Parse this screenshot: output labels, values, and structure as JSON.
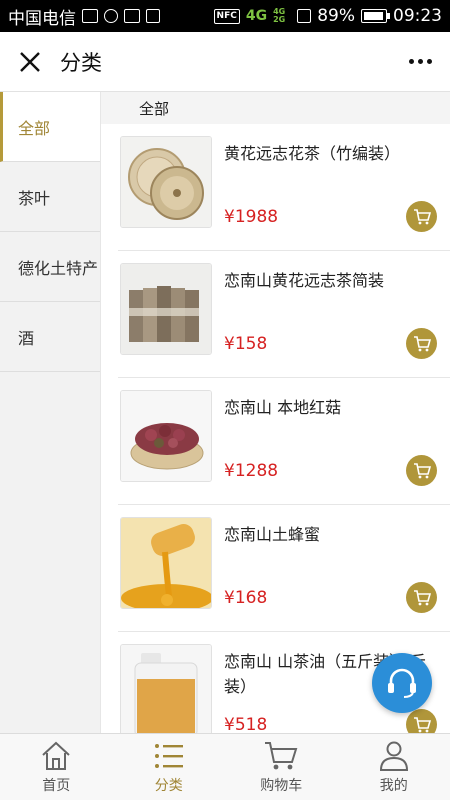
{
  "status_bar": {
    "carrier": "中国电信",
    "nfc": "NFC",
    "network": "4G",
    "network_small_top": "4G",
    "network_small_bottom": "2G",
    "battery": "89%",
    "time": "09:23"
  },
  "header": {
    "title": "分类"
  },
  "sidebar": {
    "items": [
      {
        "label": "全部",
        "active": true
      },
      {
        "label": "茶叶"
      },
      {
        "label": "德化土特产"
      },
      {
        "label": "酒"
      }
    ]
  },
  "main": {
    "category_header": "全部",
    "products": [
      {
        "name": "黄花远志花茶（竹编装）",
        "price": "¥1988"
      },
      {
        "name": "恋南山黄花远志茶简装",
        "price": "¥158"
      },
      {
        "name": "恋南山 本地红菇",
        "price": "¥1288"
      },
      {
        "name": "恋南山土蜂蜜",
        "price": "¥168"
      },
      {
        "name": "恋南山 山茶油（五斤装） 斤装）",
        "price": "¥518"
      }
    ]
  },
  "tabbar": {
    "tabs": [
      {
        "label": "首页"
      },
      {
        "label": "分类",
        "active": true
      },
      {
        "label": "购物车"
      },
      {
        "label": "我的"
      }
    ]
  },
  "colors": {
    "accent": "#b0963a",
    "price": "#d62222",
    "service": "#2b8ed8"
  }
}
